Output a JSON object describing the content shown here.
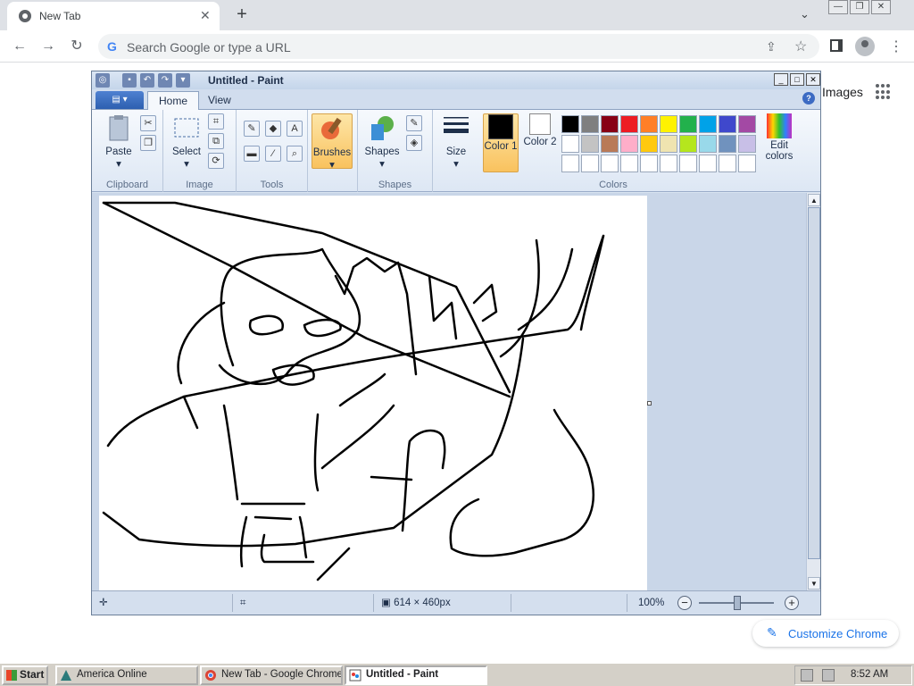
{
  "browser": {
    "tab_title": "New Tab",
    "tab_close": "✕",
    "new_tab": "+",
    "tab_search": "⌄",
    "omnibox_placeholder": "Search Google or type a URL",
    "omnibox_g": "G",
    "window_controls": [
      "—",
      "❐",
      "✕"
    ],
    "ntp_images_link": "Images",
    "customize_label": "Customize Chrome",
    "colors": {
      "accent": "#1a73e8"
    }
  },
  "paint": {
    "title": "Untitled - Paint",
    "window_controls": [
      "_",
      "□",
      "✕"
    ],
    "tabs": [
      "Home",
      "View"
    ],
    "help": "?",
    "groups": {
      "clipboard": "Clipboard",
      "image": "Image",
      "tools": "Tools",
      "shapes_group": "Shapes",
      "colors": "Colors"
    },
    "buttons": {
      "paste": "Paste",
      "select": "Select",
      "brushes": "Brushes",
      "shapes": "Shapes",
      "size": "Size",
      "color1": "Color 1",
      "color2": "Color 2",
      "edit_colors": "Edit colors"
    },
    "palette_row1": [
      "#000000",
      "#7f7f7f",
      "#880015",
      "#ed1c24",
      "#ff7f27",
      "#fff200",
      "#22b14c",
      "#00a2e8",
      "#3f48cc",
      "#a349a4"
    ],
    "palette_row2": [
      "#ffffff",
      "#c3c3c3",
      "#b97a57",
      "#ffaec9",
      "#ffc90e",
      "#efe4b0",
      "#b5e61d",
      "#99d9ea",
      "#7092be",
      "#c8bfe7"
    ],
    "color1_value": "#000000",
    "color2_value": "#ffffff",
    "status": {
      "canvas_size": "614 × 460px",
      "zoom": "100%"
    }
  },
  "taskbar": {
    "start": "Start",
    "items": [
      {
        "label": "America  Online",
        "active": false
      },
      {
        "label": "New Tab - Google Chrome",
        "active": false
      },
      {
        "label": "Untitled - Paint",
        "active": true
      }
    ],
    "clock": "8:52 AM"
  }
}
